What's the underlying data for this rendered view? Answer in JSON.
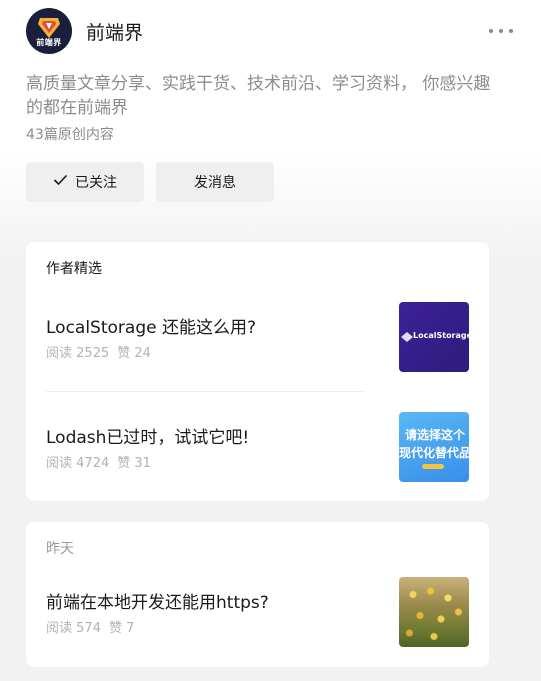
{
  "account": {
    "name": "前端界",
    "avatar_text": "前端界",
    "description": "高质量文章分享、实践干货、技术前沿、学习资料， 你感兴趣的都在前端界",
    "article_count": "43篇原创内容"
  },
  "actions": {
    "follow_label": "已关注",
    "message_label": "发消息"
  },
  "featured": {
    "title": "作者精选",
    "articles": [
      {
        "title": "LocalStorage 还能这么用?",
        "reads_label": "阅读",
        "reads": "2525",
        "likes_label": "赞",
        "likes": "24",
        "thumbnail_text": "LocalStorage"
      },
      {
        "title": "Lodash已过时，试试它吧!",
        "reads_label": "阅读",
        "reads": "4724",
        "likes_label": "赞",
        "likes": "31",
        "thumbnail_line1": "请选择这个",
        "thumbnail_line2": "现代化替代品"
      }
    ]
  },
  "yesterday": {
    "title": "昨天",
    "articles": [
      {
        "title": "前端在本地开发还能用https?",
        "reads_label": "阅读",
        "reads": "574",
        "likes_label": "赞",
        "likes": "7"
      }
    ]
  },
  "colors": {
    "background": "#f2f2f2",
    "card": "#ffffff",
    "button": "#efefef",
    "muted_text": "#8c8c8c",
    "stats_text": "#b2b2b2"
  },
  "icons": {
    "more": "more-dots-icon",
    "check": "check-icon"
  }
}
